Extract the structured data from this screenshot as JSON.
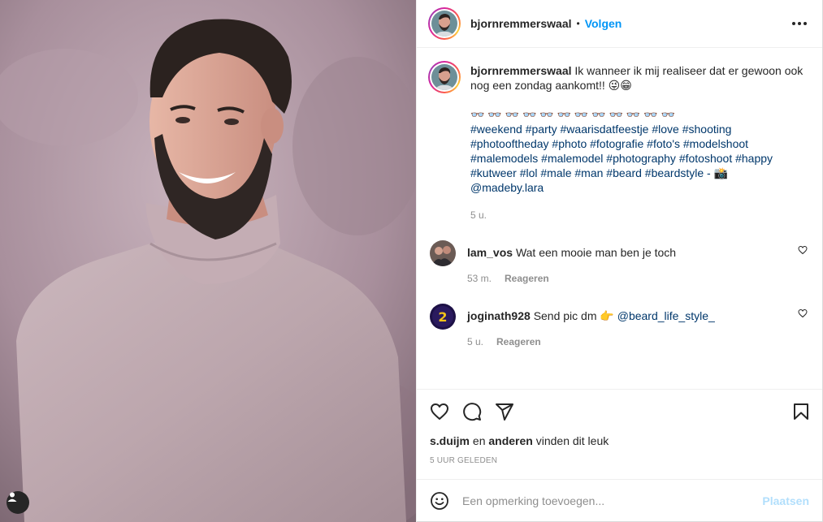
{
  "post": {
    "author": "bjornremmerswaal",
    "follow_label": "Volgen",
    "dot": "•"
  },
  "caption": {
    "username": "bjornremmerswaal",
    "text": "Ik wanneer ik mij realiseer dat er gewoon ook nog een zondag aankomt!! 😜😁",
    "glasses": "👓 👓 👓 👓 👓 👓 👓 👓 👓 👓 👓 👓",
    "hashtags_line1": "#weekend #party #waarisdatfeestje #love #shooting",
    "hashtags_line2": "#photooftheday #photo #fotografie #foto's #modelshoot",
    "hashtags_line3": "#malemodels #malemodel #photography #fotoshoot #happy",
    "hashtags_line4": "#kutweer #lol #male #man #beard #beardstyle -",
    "camera_emoji": "📸",
    "mention": "@madeby.lara",
    "time": "5 u."
  },
  "comments": [
    {
      "username": "lam_vos",
      "text": "Wat een mooie man ben je toch",
      "time": "53 m.",
      "reply_label": "Reageren"
    },
    {
      "username": "joginath928",
      "text": "Send pic dm 👉",
      "mention": "@beard_life_style_",
      "time": "5 u.",
      "reply_label": "Reageren"
    }
  ],
  "likes": {
    "first_user": "s.duijm",
    "and": "en",
    "others": "anderen",
    "suffix": "vinden dit leuk"
  },
  "timestamp": "5 uur geleden",
  "add_comment": {
    "placeholder": "Een opmerking toevoegen...",
    "post_label": "Plaatsen"
  },
  "colors": {
    "link": "#00376b",
    "follow": "#0095f6",
    "post_disabled": "#b2dffc",
    "muted": "#8e8e8e"
  },
  "icons": [
    "user-tag-icon",
    "more-options-icon",
    "heart-icon",
    "comment-icon",
    "share-icon",
    "bookmark-icon",
    "emoji-icon"
  ]
}
